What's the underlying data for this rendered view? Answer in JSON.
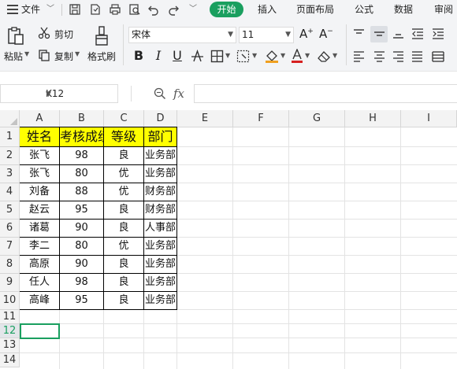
{
  "menu": {
    "file_label": "文件",
    "tabs": [
      "开始",
      "插入",
      "页面布局",
      "公式",
      "数据",
      "审阅"
    ]
  },
  "ribbon": {
    "paste_label": "粘贴",
    "cut_label": "剪切",
    "copy_label": "复制",
    "format_painter_label": "格式刷",
    "font_name": "宋体",
    "font_size": "11"
  },
  "formula_bar": {
    "cell_ref": "K12",
    "fx_label": "fx",
    "formula_value": ""
  },
  "sheet": {
    "columns": [
      "A",
      "B",
      "C",
      "D",
      "E",
      "F",
      "G",
      "H",
      "I"
    ],
    "rows": [
      "1",
      "2",
      "3",
      "4",
      "5",
      "6",
      "7",
      "8",
      "9",
      "10",
      "11",
      "12",
      "13",
      "14"
    ],
    "active_row": "12",
    "header": [
      "姓名",
      "考核成绩",
      "等级",
      "部门"
    ],
    "data": [
      [
        "张飞",
        "98",
        "良",
        "业务部"
      ],
      [
        "张飞",
        "80",
        "优",
        "业务部"
      ],
      [
        "刘备",
        "88",
        "优",
        "财务部"
      ],
      [
        "赵云",
        "95",
        "良",
        "财务部"
      ],
      [
        "诸葛",
        "90",
        "良",
        "人事部"
      ],
      [
        "李二",
        "80",
        "优",
        "业务部"
      ],
      [
        "高原",
        "90",
        "良",
        "业务部"
      ],
      [
        "任人",
        "98",
        "良",
        "业务部"
      ],
      [
        "高峰",
        "95",
        "良",
        "业务部"
      ]
    ]
  },
  "colors": {
    "accent": "#1a9f5f",
    "header_fill": "#ffff00"
  }
}
